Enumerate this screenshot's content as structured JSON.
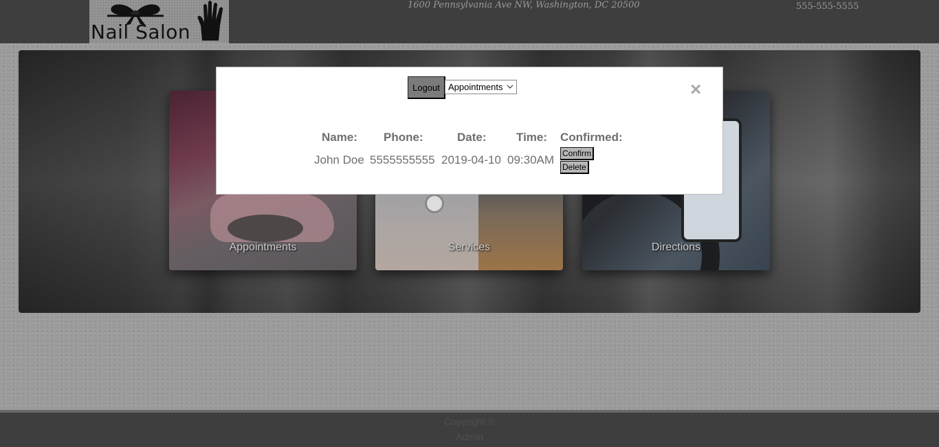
{
  "header": {
    "logo_text": "Nail Salon",
    "address": "1600 Pennsylvania Ave NW, Washington, DC 20500",
    "phone": "555-555-5555"
  },
  "cards": [
    {
      "label": "Appointments"
    },
    {
      "label": "Services"
    },
    {
      "label": "Directions"
    }
  ],
  "footer": {
    "line1": "Copyright ©",
    "line2": "Admin"
  },
  "modal": {
    "logout_label": "Logout",
    "view_select": {
      "selected": "Appointments"
    },
    "close_glyph": "×",
    "columns": [
      "Name:",
      "Phone:",
      "Date:",
      "Time:",
      "Confirmed:"
    ],
    "rows": [
      {
        "name": "John Doe",
        "phone": "5555555555",
        "date": "2019-04-10",
        "time": "09:30AM",
        "confirm_label": "Confirm",
        "delete_label": "Delete"
      }
    ]
  }
}
